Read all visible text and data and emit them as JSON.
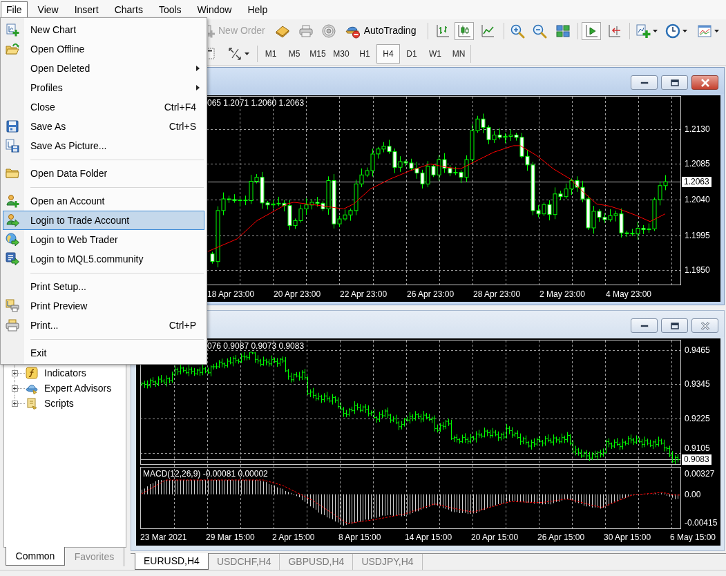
{
  "menu_bar": {
    "items": [
      {
        "label": "File",
        "selected": true
      },
      {
        "label": "View",
        "selected": false
      },
      {
        "label": "Insert",
        "selected": false
      },
      {
        "label": "Charts",
        "selected": false
      },
      {
        "label": "Tools",
        "selected": false
      },
      {
        "label": "Window",
        "selected": false
      },
      {
        "label": "Help",
        "selected": false
      }
    ]
  },
  "file_menu": {
    "items": [
      {
        "kind": "item",
        "label": "New Chart",
        "selected": false
      },
      {
        "kind": "item",
        "label": "Open Offline",
        "selected": false
      },
      {
        "kind": "submenu",
        "label": "Open Deleted",
        "selected": false
      },
      {
        "kind": "submenu",
        "label": "Profiles",
        "selected": false
      },
      {
        "kind": "item",
        "label": "Close",
        "shortcut": "Ctrl+F4",
        "selected": false
      },
      {
        "kind": "item",
        "label": "Save As",
        "shortcut": "Ctrl+S",
        "selected": false
      },
      {
        "kind": "item",
        "label": "Save As Picture...",
        "selected": false
      },
      {
        "kind": "separator"
      },
      {
        "kind": "item",
        "label": "Open Data Folder",
        "selected": false
      },
      {
        "kind": "separator"
      },
      {
        "kind": "item",
        "label": "Open an Account",
        "selected": false
      },
      {
        "kind": "item",
        "label": "Login to Trade Account",
        "selected": true
      },
      {
        "kind": "item",
        "label": "Login to Web Trader",
        "selected": false
      },
      {
        "kind": "item",
        "label": "Login to MQL5.community",
        "selected": false
      },
      {
        "kind": "separator"
      },
      {
        "kind": "item",
        "label": "Print Setup...",
        "selected": false
      },
      {
        "kind": "item",
        "label": "Print Preview",
        "selected": false
      },
      {
        "kind": "item",
        "label": "Print...",
        "shortcut": "Ctrl+P",
        "selected": false
      },
      {
        "kind": "separator"
      },
      {
        "kind": "item",
        "label": "Exit",
        "selected": false
      }
    ]
  },
  "toolbar": {
    "new_order": {
      "label": "New Order",
      "disabled": true
    },
    "auto_trading": {
      "label": "AutoTrading"
    },
    "chart_types": [
      {
        "selected": false
      },
      {
        "selected": true
      },
      {
        "selected": false
      }
    ],
    "auto_scroll": {
      "pressed": true
    },
    "chart_shift": {
      "pressed": false
    }
  },
  "timeframes": [
    {
      "label": "M1",
      "selected": false
    },
    {
      "label": "M5",
      "selected": false
    },
    {
      "label": "M15",
      "selected": false
    },
    {
      "label": "M30",
      "selected": false
    },
    {
      "label": "H1",
      "selected": false
    },
    {
      "label": "H4",
      "selected": true
    },
    {
      "label": "D1",
      "selected": false
    },
    {
      "label": "W1",
      "selected": false
    },
    {
      "label": "MN",
      "selected": false
    }
  ],
  "navigator": {
    "tree": [
      {
        "label": "Indicators",
        "expanded": false
      },
      {
        "label": "Expert Advisors",
        "expanded": false
      },
      {
        "label": "Scripts",
        "expanded": false
      }
    ],
    "tabs": [
      {
        "label": "Common",
        "selected": true
      },
      {
        "label": "Favorites",
        "selected": false
      }
    ]
  },
  "chart_windows": [
    {
      "kind": "candles",
      "active": true,
      "ohlc": "065 1.2071 1.2060 1.2063",
      "price_labels": [
        "1.2130",
        "1.2085",
        "1.2040",
        "1.1995",
        "1.1950"
      ],
      "current_price": "1.2063",
      "time_labels": [
        "18 Apr 23:00",
        "20 Apr 23:00",
        "22 Apr 23:00",
        "26 Apr 23:00",
        "28 Apr 23:00",
        "2 May 23:00",
        "4 May 23:00"
      ]
    },
    {
      "kind": "bars",
      "active": false,
      "ohlc": "076 0.9087 0.9073 0.9083",
      "price_labels": [
        "0.9465",
        "0.9345",
        "0.9225",
        "0.9105"
      ],
      "current_price": "0.9083",
      "indicator": {
        "label": "MACD(12,26,9) -0.00081 0.00002",
        "scale_labels": [
          "0.00327",
          "0.00",
          "-0.00415"
        ]
      },
      "time_labels": [
        "23 Mar 2021",
        "29 Mar 15:00",
        "2 Apr 15:00",
        "8 Apr 15:00",
        "14 Apr 15:00",
        "20 Apr 15:00",
        "26 Apr 15:00",
        "30 Apr 15:00",
        "6 May 15:00"
      ]
    }
  ],
  "chart_tabs": [
    {
      "label": "EURUSD,H4",
      "selected": true
    },
    {
      "label": "USDCHF,H4",
      "selected": false
    },
    {
      "label": "GBPUSD,H4",
      "selected": false
    },
    {
      "label": "USDJPY,H4",
      "selected": false
    }
  ]
}
